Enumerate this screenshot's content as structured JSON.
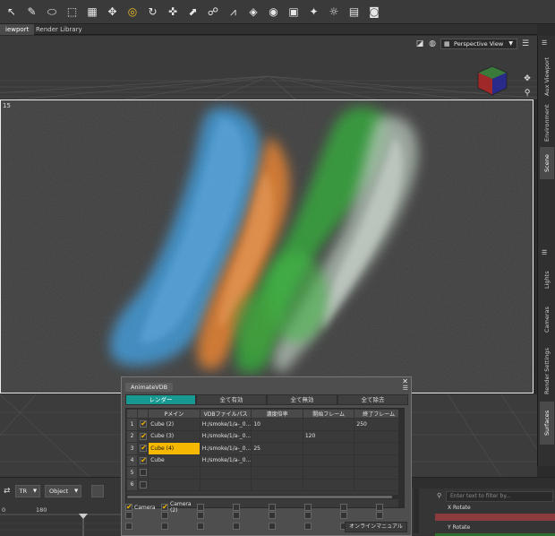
{
  "toolbar": {
    "tools": [
      {
        "name": "pointer-icon",
        "glyph": "↖"
      },
      {
        "name": "pen-icon",
        "glyph": "✎"
      },
      {
        "name": "node-icon",
        "glyph": "⬭"
      },
      {
        "name": "region-icon",
        "glyph": "⬚"
      },
      {
        "name": "transform-icon",
        "glyph": "▦"
      },
      {
        "name": "move-icon",
        "glyph": "✥"
      },
      {
        "name": "universal-icon",
        "glyph": "◎"
      },
      {
        "name": "rotate-icon",
        "glyph": "↻"
      },
      {
        "name": "translate-icon",
        "glyph": "✜"
      },
      {
        "name": "scale-icon",
        "glyph": "⬈"
      },
      {
        "name": "joint-icon",
        "glyph": "☍"
      },
      {
        "name": "bone-icon",
        "glyph": "⩘"
      },
      {
        "name": "geometry-icon",
        "glyph": "◈"
      },
      {
        "name": "camera-icon",
        "glyph": "◉"
      },
      {
        "name": "camera-alt-icon",
        "glyph": "▣"
      },
      {
        "name": "spot-icon",
        "glyph": "✦"
      },
      {
        "name": "light-icon",
        "glyph": "☼"
      },
      {
        "name": "node-camera-icon",
        "glyph": "▤"
      },
      {
        "name": "render-icon",
        "glyph": "◙"
      }
    ]
  },
  "tabs": [
    {
      "label": "iewport",
      "active": true
    },
    {
      "label": "Render Library",
      "active": false
    }
  ],
  "viewport": {
    "view_label": "Perspective View",
    "frame_number": "15"
  },
  "right_tabs": [
    {
      "label": "Aux Viewport",
      "active": false
    },
    {
      "label": "Environment",
      "active": false
    },
    {
      "label": "Scene",
      "active": true
    },
    {
      "label": "Lights",
      "active": false
    },
    {
      "label": "Cameras",
      "active": false
    },
    {
      "label": "Render Settings",
      "active": false
    },
    {
      "label": "Surfaces",
      "active": true
    }
  ],
  "bottom_bar": {
    "tr_label": "TR",
    "object_label": "Object",
    "timeline_labels": [
      "0",
      "180"
    ]
  },
  "dialog": {
    "title": "AnimateVDB",
    "tabs": [
      "レンダー",
      "全て有効",
      "全て無効",
      "全て除去"
    ],
    "columns": [
      "",
      "",
      "Pメイン",
      "VDBファイルパス",
      "濃度倍率",
      "開始フレーム",
      "終了フレーム"
    ],
    "rows": [
      {
        "num": "1",
        "checked": true,
        "name": "Cube (2)",
        "path": "H:/smoke/1/a-_0...",
        "density": "10",
        "start": "",
        "end": "250",
        "selected": false
      },
      {
        "num": "2",
        "checked": true,
        "name": "Cube (3)",
        "path": "H:/smoke/1/a-_0...",
        "density": "",
        "start": "120",
        "end": "",
        "selected": false
      },
      {
        "num": "3",
        "checked": true,
        "name": "Cube (4)",
        "path": "H:/smoke/1/a-_0...",
        "density": "25",
        "start": "",
        "end": "",
        "selected": true
      },
      {
        "num": "4",
        "checked": true,
        "name": "Cube",
        "path": "H:/smoke/1/a-_0...",
        "density": "",
        "start": "",
        "end": "",
        "selected": false
      },
      {
        "num": "5",
        "checked": false,
        "name": "",
        "path": "",
        "density": "",
        "start": "",
        "end": "",
        "selected": false
      },
      {
        "num": "6",
        "checked": false,
        "name": "",
        "path": "",
        "density": "",
        "start": "",
        "end": "",
        "selected": false
      }
    ],
    "camera_labels": [
      "Camera",
      "Camera (2)"
    ],
    "manual_label": "オンラインマニュアル"
  },
  "right_panel": {
    "filter_placeholder": "Enter text to filter by...",
    "x_rotate": "X Rotate",
    "y_rotate": "Y Rotate"
  }
}
